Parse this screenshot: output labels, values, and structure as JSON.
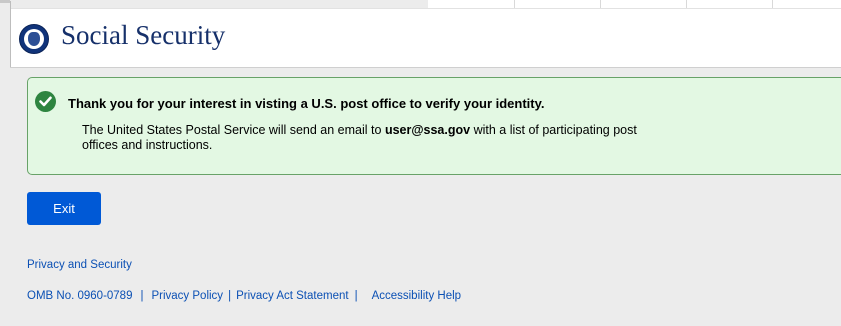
{
  "header": {
    "title": "Social Security"
  },
  "alert": {
    "title": "Thank you for your interest in visting a U.S. post office to verify your identity.",
    "body_prefix": "The United States Postal Service will send an email to ",
    "email": "user@ssa.gov",
    "body_suffix": " with a list of participating post offices and instructions."
  },
  "actions": {
    "exit_label": "Exit"
  },
  "footer": {
    "privacy_security": "Privacy and Security",
    "omb": "OMB No. 0960-0789",
    "separator": "|",
    "privacy_policy": "Privacy Policy",
    "privacy_act": "Privacy Act Statement",
    "accessibility": "Accessibility Help"
  },
  "colors": {
    "brand": "#16306a",
    "success_bg": "#e3f8e3",
    "success_border": "#68a268",
    "success_icon": "#2e8540",
    "primary_button": "#0059d6",
    "link": "#0b50b4",
    "page_bg": "#ececec"
  },
  "icons": {
    "logo": "ssa-seal-icon",
    "alert": "check-circle-icon"
  }
}
